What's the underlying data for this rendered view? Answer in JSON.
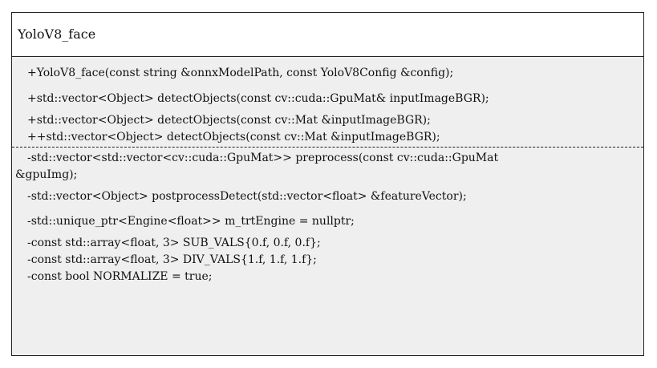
{
  "diagram": {
    "class_name": "YoloV8_face",
    "public_members": [
      "+YoloV8_face(const string &onnxModelPath, const YoloV8Config &config);",
      "+std::vector<Object> detectObjects(const cv::cuda::GpuMat& inputImageBGR);",
      "+std::vector<Object> detectObjects(const cv::Mat &inputImageBGR);",
      "++std::vector<Object> detectObjects(const cv::Mat &inputImageBGR);"
    ],
    "private_members": [
      "-std::vector<std::vector<cv::cuda::GpuMat>> preprocess(const cv::cuda::GpuMat",
      "&gpuImg);",
      "-std::vector<Object> postprocessDetect(std::vector<float> &featureVector);",
      "-std::unique_ptr<Engine<float>> m_trtEngine = nullptr;",
      "-const std::array<float, 3> SUB_VALS{0.f, 0.f, 0.f};",
      "-const std::array<float, 3> DIV_VALS{1.f, 1.f, 1.f};",
      "-const bool NORMALIZE = true;"
    ]
  }
}
